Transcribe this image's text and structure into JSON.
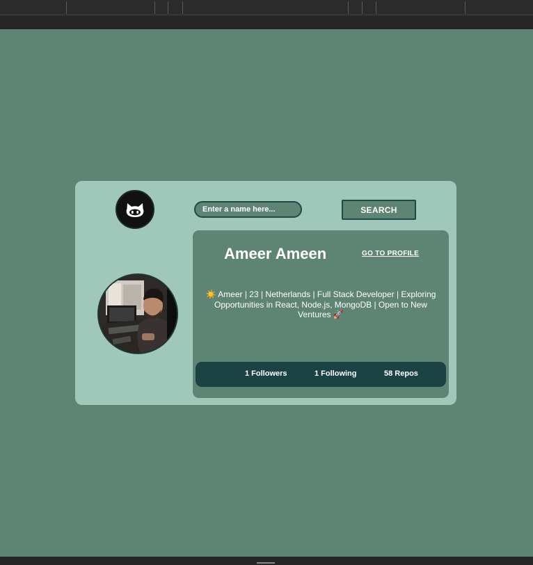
{
  "search": {
    "placeholder": "Enter a name here...",
    "button_label": "SEARCH"
  },
  "profile": {
    "name": "Ameer Ameen",
    "goto_label": "GO TO PROFILE",
    "bio": "☀️ Ameer | 23 | Netherlands | Full Stack Developer | Exploring Opportunities in React, Node.js, MongoDB | Open to New Ventures 🚀",
    "avatar_icon": "user-photo",
    "logo_icon": "github-octocat-icon"
  },
  "stats": {
    "followers": "1 Followers",
    "following": "1 Following",
    "repos": "58 Repos"
  },
  "colors": {
    "page_bg": "#5e8474",
    "card_bg": "#9fc7ba",
    "panel_bg": "#5e8474",
    "stats_bg": "#1c4343",
    "border": "#1f4a44"
  }
}
